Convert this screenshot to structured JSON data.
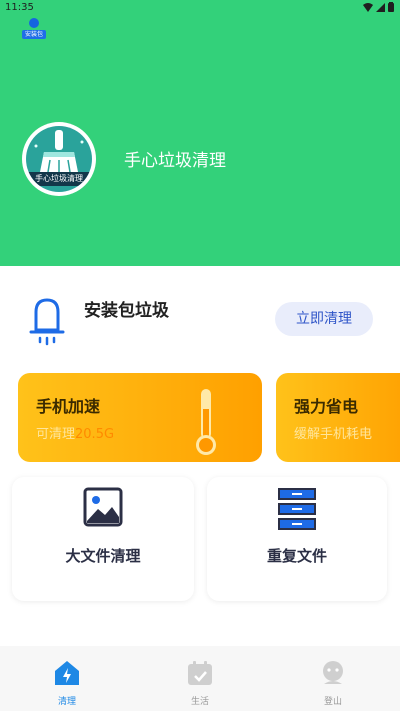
{
  "status_bar": {
    "time": "11:35"
  },
  "notification": {
    "tag": "安装包"
  },
  "app": {
    "name": "手心垃圾清理",
    "logo_caption": "手心垃圾清理"
  },
  "apk": {
    "title": "安装包垃圾",
    "button": "立即清理"
  },
  "cards": {
    "speed": {
      "title": "手机加速",
      "sub_prefix": "可清理",
      "sub_value": "20.5G"
    },
    "power": {
      "title": "强力省电",
      "sub": "缓解手机耗电"
    }
  },
  "tiles": {
    "big_files": "大文件清理",
    "duplicates": "重复文件"
  },
  "tabs": [
    {
      "label": "清理",
      "active": true
    },
    {
      "label": "生活",
      "active": false
    },
    {
      "label": "登山",
      "active": false
    }
  ],
  "colors": {
    "header": "#33d17a",
    "accent": "#1e88e5",
    "card": "#ffb000"
  }
}
